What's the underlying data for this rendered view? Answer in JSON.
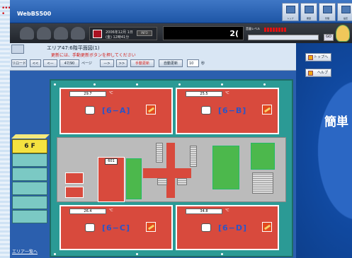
{
  "app": {
    "title": "WebBS500"
  },
  "top_toolbar": {
    "tools": [
      {
        "label": "トップ",
        "icon": "monitor-icon"
      },
      {
        "label": "履歴",
        "icon": "history-icon"
      },
      {
        "label": "管理",
        "icon": "manage-icon"
      },
      {
        "label": "設定",
        "icon": "settings-icon"
      }
    ]
  },
  "status_bar": {
    "date_line1": "2006年12月 1日",
    "date_line2": "(金)  12時41分",
    "info_label": "INFO",
    "display_value": "2(",
    "level_label": "音量レベル",
    "select_value": "",
    "go_label": "GO"
  },
  "nav": {
    "area_title": "エリア47:6階平面図(1)",
    "notice": "更新には、手動更新ボタンを押してください",
    "reload_label": "リロード",
    "page_value": "47/90",
    "page_suffix": "ページ",
    "manual_update": "手動更新",
    "auto_update": "自動更新",
    "interval_value": "10",
    "interval_unit": "秒"
  },
  "side": {
    "top_button": "トップへ",
    "help_button": "ヘルプ",
    "big_text": "簡単"
  },
  "floor": {
    "label": "6 F",
    "area_list_link": "エリア一覧へ"
  },
  "rooms": [
    {
      "name": "[6−A]",
      "temp": "29.7",
      "unit": "℃"
    },
    {
      "name": "[6−B]",
      "temp": "25.5",
      "unit": "℃"
    },
    {
      "name": "[6−C]",
      "temp": "26.4",
      "unit": "℃"
    },
    {
      "name": "[6−D]",
      "temp": "34.8",
      "unit": "℃"
    }
  ],
  "inner": {
    "room_box": "601"
  }
}
